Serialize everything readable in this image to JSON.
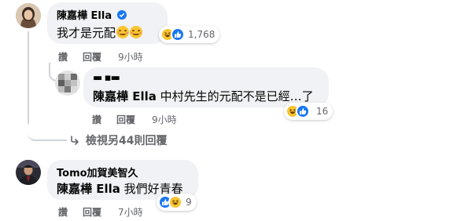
{
  "comments": [
    {
      "author": "陳嘉樺 Ella",
      "verified": true,
      "text": "我才是元配",
      "text_emoji": "smiling-face-emoji",
      "reaction_count": "1,768",
      "reactions": [
        "haha",
        "like"
      ],
      "actions": [
        "讚",
        "回覆"
      ],
      "time": "9小時"
    },
    {
      "author": "▬ ▪▬",
      "mention": "陳嘉樺 Ella",
      "text": " 中村先生的元配不是已經…了",
      "reaction_count": "16",
      "reactions": [
        "haha",
        "like"
      ],
      "actions": [
        "讚",
        "回覆"
      ],
      "time": "9小時"
    },
    {
      "author": "Tomo加賀美智久",
      "mention": "陳嘉樺 Ella",
      "text": " 我們好青春",
      "reaction_count": "9",
      "reactions": [
        "like",
        "haha"
      ],
      "actions": [
        "讚",
        "回覆"
      ],
      "time": "7小時"
    }
  ],
  "view_more_replies": "檢視另44則回覆",
  "colors": {
    "bubble": "#f0f2f5",
    "secondary_text": "#65676b",
    "like_blue": "#1877f2",
    "haha_yellow": "#f7c531"
  }
}
